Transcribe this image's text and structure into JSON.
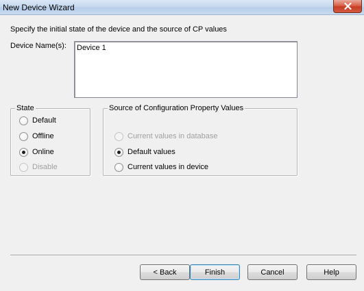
{
  "window": {
    "title": "New Device Wizard"
  },
  "instruction": "Specify the initial state of the device and the source of CP values",
  "device_names": {
    "label": "Device Name(s):",
    "value": "Device 1"
  },
  "state_group": {
    "title": "State",
    "options": [
      {
        "label": "Default",
        "checked": false,
        "disabled": false
      },
      {
        "label": "Offline",
        "checked": false,
        "disabled": false
      },
      {
        "label": "Online",
        "checked": true,
        "disabled": false
      },
      {
        "label": "Disable",
        "checked": false,
        "disabled": true
      }
    ]
  },
  "source_group": {
    "title": "Source of Configuration Property Values",
    "options": [
      {
        "label": "Current values in database",
        "checked": false,
        "disabled": true
      },
      {
        "label": "Default values",
        "checked": true,
        "disabled": false
      },
      {
        "label": "Current values in device",
        "checked": false,
        "disabled": false
      }
    ]
  },
  "buttons": {
    "back": "< Back",
    "finish": "Finish",
    "cancel": "Cancel",
    "help": "Help"
  },
  "colors": {
    "background": "#f0f0f0",
    "close_button": "#c43e24",
    "disabled_text": "#a0a0a0"
  }
}
